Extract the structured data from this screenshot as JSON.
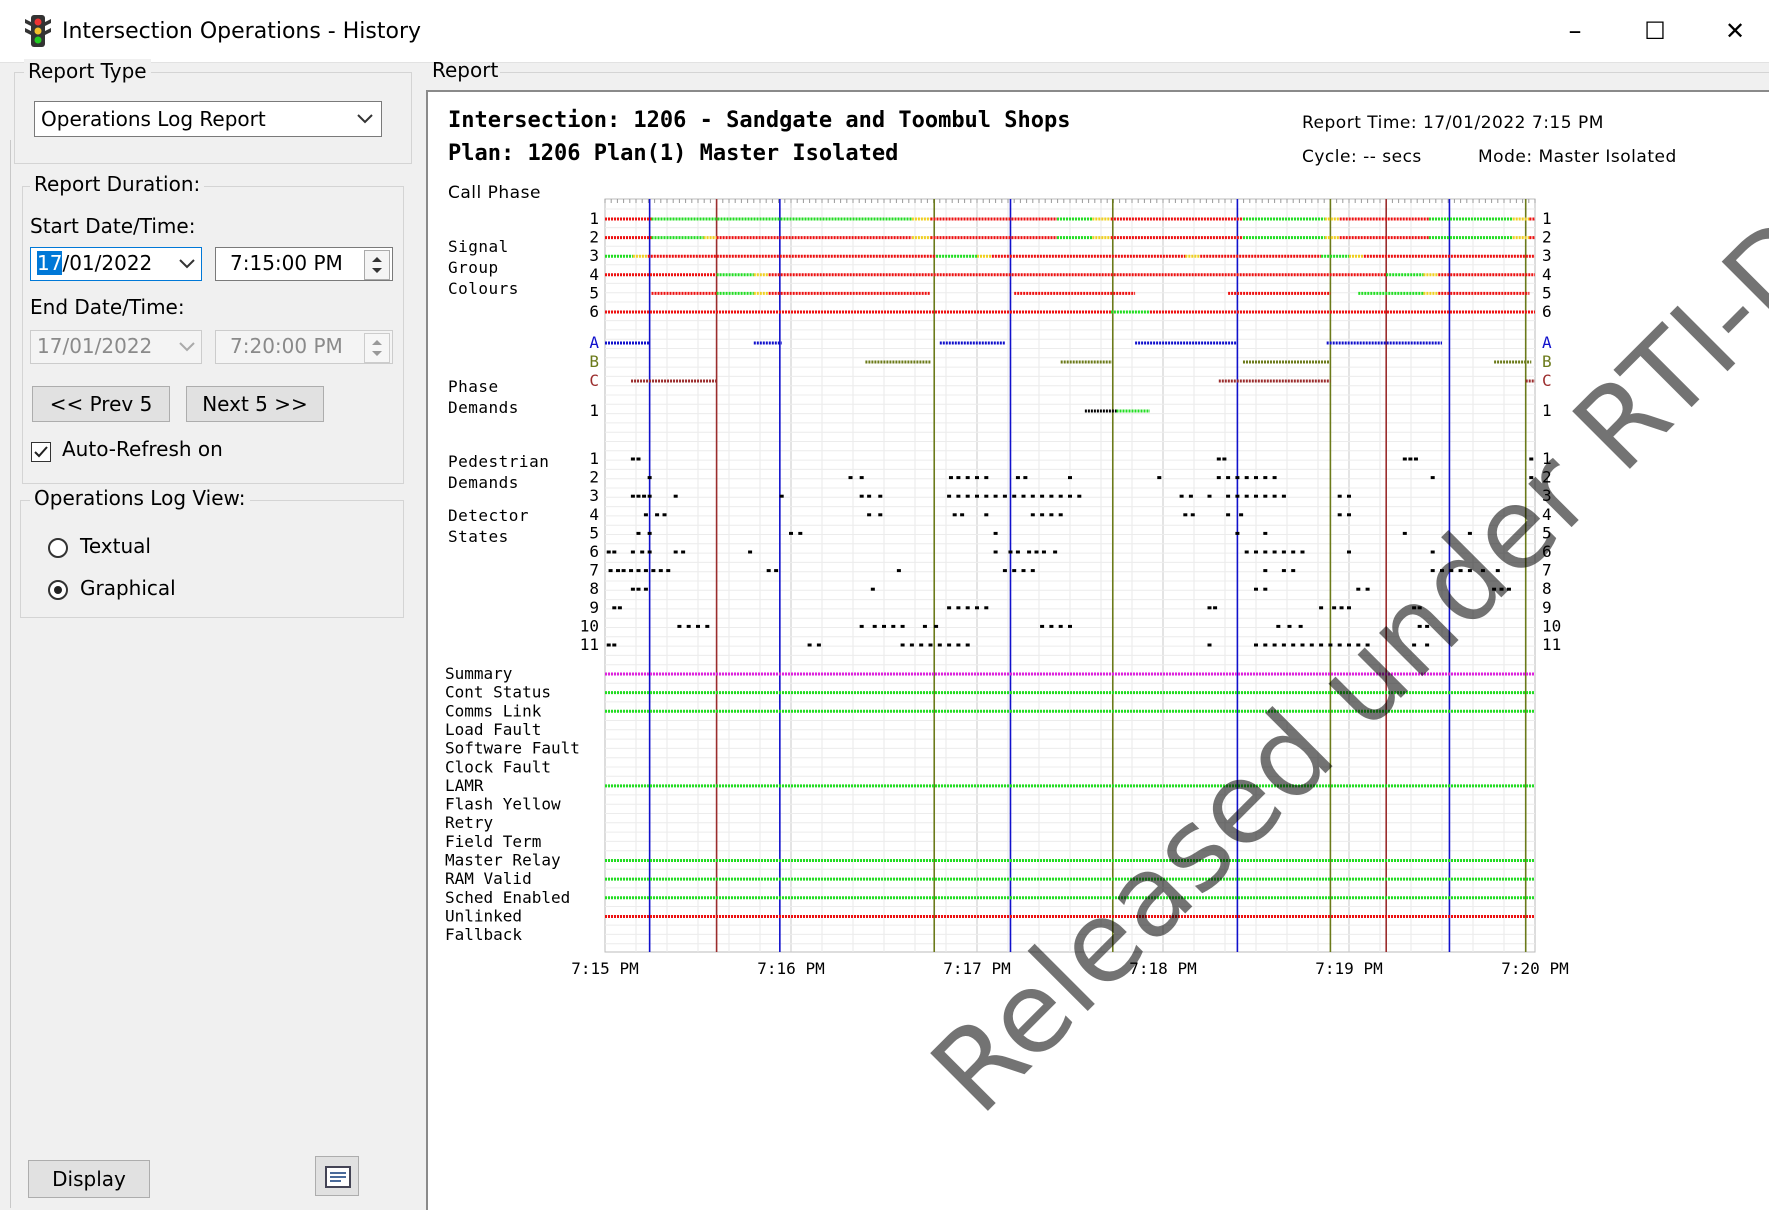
{
  "window": {
    "title": "Intersection Operations - History",
    "icon": "traffic-light-icon",
    "controls": [
      "–",
      "☐",
      "✕"
    ]
  },
  "report_type": {
    "group_label": "Report Type",
    "selected": "Operations Log Report"
  },
  "duration": {
    "group_label": "Report Duration:",
    "start_label": "Start Date/Time:",
    "start_date_sel": "17",
    "start_date_rest": "/01/2022",
    "start_time": "7:15:00 PM",
    "end_label": "End Date/Time:",
    "end_date": "17/01/2022",
    "end_time": "7:20:00 PM",
    "prev_label": "<< Prev 5",
    "next_label": "Next 5 >>",
    "auto_refresh_label": "Auto-Refresh on",
    "auto_refresh_checked": true
  },
  "log_view": {
    "group_label": "Operations Log View:",
    "options": [
      "Textual",
      "Graphical"
    ],
    "selected": "Graphical"
  },
  "footer": {
    "display_label": "Display"
  },
  "report": {
    "pane_label": "Report",
    "intersection": "Intersection: 1206 - Sandgate and Toombul Shops",
    "plan": "Plan: 1206 Plan(1) Master Isolated",
    "report_time": "Report Time:  17/01/2022 7:15 PM",
    "cycle": "Cycle: -- secs",
    "mode": "Mode: Master Isolated",
    "call_phase_label": "Call Phase",
    "watermark": "Released under RTI-DTMR"
  },
  "chart_data": {
    "type": "timeline",
    "x_ticks": [
      "7:15 PM",
      "7:16 PM",
      "7:17 PM",
      "7:18 PM",
      "7:19 PM",
      "7:20 PM"
    ],
    "x_range_min": [
      0,
      5
    ],
    "colors": {
      "red": "#ee1111",
      "green": "#22dd22",
      "yellow": "#f0d020",
      "blue": "#1111cc",
      "olive": "#6b7a1a",
      "maroon": "#9b2d2d",
      "magenta": "#dd22dd",
      "black": "#000000"
    },
    "section_labels": {
      "signal_group": "Signal\nGroup\nColours",
      "phase": "Phase\nDemands",
      "ped": "Pedestrian\nDemands",
      "detector": "Detector\nStates"
    },
    "signal_groups": [
      {
        "label": "1",
        "segments": [
          [
            0,
            0.25,
            "red"
          ],
          [
            0.25,
            1.65,
            "green"
          ],
          [
            1.65,
            1.75,
            "yellow"
          ],
          [
            1.75,
            2.43,
            "red"
          ],
          [
            2.43,
            2.62,
            "green"
          ],
          [
            2.62,
            2.72,
            "yellow"
          ],
          [
            2.72,
            3.43,
            "red"
          ],
          [
            3.43,
            3.87,
            "green"
          ],
          [
            3.87,
            3.95,
            "yellow"
          ],
          [
            3.95,
            4.43,
            "red"
          ],
          [
            4.43,
            4.88,
            "green"
          ],
          [
            4.88,
            4.97,
            "yellow"
          ],
          [
            4.97,
            5,
            "red"
          ]
        ]
      },
      {
        "label": "2",
        "segments": [
          [
            0,
            0.25,
            "red"
          ],
          [
            0.25,
            0.53,
            "green"
          ],
          [
            0.53,
            0.6,
            "yellow"
          ],
          [
            0.6,
            1.65,
            "red"
          ],
          [
            1.65,
            1.75,
            "yellow"
          ],
          [
            1.75,
            2.43,
            "red"
          ],
          [
            2.43,
            2.62,
            "green"
          ],
          [
            2.62,
            2.72,
            "yellow"
          ],
          [
            2.72,
            3.43,
            "red"
          ],
          [
            3.43,
            3.87,
            "green"
          ],
          [
            3.87,
            3.95,
            "yellow"
          ],
          [
            3.95,
            4.43,
            "red"
          ],
          [
            4.43,
            4.88,
            "green"
          ],
          [
            4.88,
            4.97,
            "yellow"
          ],
          [
            4.97,
            5,
            "red"
          ]
        ]
      },
      {
        "label": "3",
        "segments": [
          [
            0,
            0.15,
            "green"
          ],
          [
            0.15,
            0.23,
            "yellow"
          ],
          [
            0.23,
            1.78,
            "red"
          ],
          [
            1.78,
            2.0,
            "green"
          ],
          [
            2.0,
            2.08,
            "yellow"
          ],
          [
            2.08,
            3.12,
            "red"
          ],
          [
            3.12,
            3.2,
            "yellow"
          ],
          [
            3.2,
            3.85,
            "red"
          ],
          [
            3.85,
            4.0,
            "green"
          ],
          [
            4.0,
            4.08,
            "yellow"
          ],
          [
            4.08,
            5,
            "red"
          ]
        ]
      },
      {
        "label": "4",
        "segments": [
          [
            0,
            0.6,
            "red"
          ],
          [
            0.6,
            0.8,
            "green"
          ],
          [
            0.8,
            0.88,
            "yellow"
          ],
          [
            0.88,
            4.2,
            "red"
          ],
          [
            4.2,
            4.4,
            "green"
          ],
          [
            4.4,
            4.48,
            "yellow"
          ],
          [
            4.48,
            5,
            "red"
          ]
        ]
      },
      {
        "label": "5",
        "segments": [
          [
            0.25,
            0.6,
            "red"
          ],
          [
            0.6,
            0.8,
            "green"
          ],
          [
            0.8,
            0.88,
            "yellow"
          ],
          [
            0.88,
            1.75,
            "red"
          ],
          [
            2.2,
            2.85,
            "red"
          ],
          [
            3.35,
            3.9,
            "red"
          ],
          [
            4.05,
            4.4,
            "green"
          ],
          [
            4.4,
            4.48,
            "yellow"
          ],
          [
            4.48,
            4.97,
            "red"
          ]
        ]
      },
      {
        "label": "6",
        "segments": [
          [
            0,
            2.72,
            "red"
          ],
          [
            2.72,
            2.93,
            "green"
          ],
          [
            2.93,
            5,
            "red"
          ]
        ]
      }
    ],
    "phase_demands": [
      {
        "label": "A",
        "color": "blue",
        "segments": [
          [
            0,
            0.24
          ],
          [
            0.8,
            0.95
          ],
          [
            1.8,
            2.15
          ],
          [
            2.85,
            3.4
          ],
          [
            3.88,
            4.5
          ]
        ]
      },
      {
        "label": "B",
        "color": "olive",
        "segments": [
          [
            1.4,
            1.75
          ],
          [
            2.45,
            2.73
          ],
          [
            3.43,
            3.9
          ],
          [
            4.78,
            4.98
          ]
        ]
      },
      {
        "label": "C",
        "color": "maroon",
        "segments": [
          [
            0.14,
            0.6
          ],
          [
            3.3,
            3.9
          ],
          [
            4.95,
            5
          ]
        ]
      }
    ],
    "ped_demands": [
      {
        "label": "1",
        "segments": [
          [
            2.58,
            2.75,
            "black"
          ],
          [
            2.75,
            2.93,
            "green"
          ]
        ]
      }
    ],
    "detectors": [
      {
        "label": "1",
        "points": [
          0.15,
          0.18,
          3.3,
          3.33,
          4.3,
          4.33,
          4.36,
          4.98
        ]
      },
      {
        "label": "2",
        "points": [
          0.24,
          1.32,
          1.38,
          1.86,
          1.9,
          1.95,
          2.0,
          2.05,
          2.22,
          2.26,
          2.5,
          2.98,
          3.3,
          3.35,
          3.4,
          3.45,
          3.5,
          3.55,
          3.6,
          4.45,
          4.98
        ]
      },
      {
        "label": "3",
        "points": [
          0.15,
          0.18,
          0.21,
          0.24,
          0.38,
          0.95,
          1.38,
          1.42,
          1.48,
          1.85,
          1.9,
          1.95,
          2.0,
          2.05,
          2.1,
          2.15,
          2.2,
          2.25,
          2.3,
          2.35,
          2.4,
          2.45,
          2.5,
          2.55,
          3.1,
          3.15,
          3.25,
          3.35,
          3.4,
          3.45,
          3.5,
          3.55,
          3.6,
          3.65,
          3.95,
          4.0
        ]
      },
      {
        "label": "4",
        "points": [
          0.22,
          0.28,
          0.32,
          1.42,
          1.48,
          1.88,
          1.92,
          2.05,
          2.3,
          2.35,
          2.4,
          2.45,
          3.12,
          3.16,
          3.35,
          3.42,
          3.95,
          4.0
        ]
      },
      {
        "label": "5",
        "points": [
          0.18,
          0.24,
          1.0,
          1.05,
          2.1,
          3.4,
          3.55,
          4.3,
          4.65
        ]
      },
      {
        "label": "6",
        "points": [
          0.02,
          0.05,
          0.15,
          0.2,
          0.24,
          0.38,
          0.42,
          0.78,
          2.1,
          2.18,
          2.22,
          2.28,
          2.32,
          2.36,
          2.42,
          3.45,
          3.5,
          3.55,
          3.6,
          3.65,
          3.7,
          3.75,
          4.0,
          4.45
        ]
      },
      {
        "label": "7",
        "points": [
          0.03,
          0.07,
          0.1,
          0.14,
          0.18,
          0.22,
          0.26,
          0.3,
          0.34,
          0.88,
          0.92,
          1.58,
          2.15,
          2.2,
          2.25,
          2.3,
          3.55,
          3.65,
          3.7,
          4.45,
          4.5,
          4.55,
          4.6,
          4.65,
          4.72,
          4.8
        ]
      },
      {
        "label": "8",
        "points": [
          0.15,
          0.18,
          0.22,
          1.44,
          3.5,
          3.55,
          4.05,
          4.1,
          4.78,
          4.82,
          4.86
        ]
      },
      {
        "label": "9",
        "points": [
          0.05,
          0.08,
          1.85,
          1.9,
          1.95,
          2.0,
          2.05,
          3.25,
          3.28,
          3.85,
          3.92,
          3.96,
          4.0,
          4.35,
          4.38
        ]
      },
      {
        "label": "10",
        "points": [
          0.4,
          0.45,
          0.5,
          0.55,
          1.38,
          1.45,
          1.5,
          1.55,
          1.6,
          1.72,
          1.78,
          2.35,
          2.4,
          2.45,
          2.5,
          3.62,
          3.68,
          3.74,
          4.38,
          4.42
        ]
      },
      {
        "label": "11",
        "points": [
          0.02,
          0.05,
          1.1,
          1.15,
          1.6,
          1.65,
          1.7,
          1.75,
          1.8,
          1.85,
          1.9,
          1.95,
          3.25,
          3.5,
          3.55,
          3.6,
          3.65,
          3.7,
          3.75,
          3.8,
          3.85,
          3.9,
          3.95,
          4.0,
          4.05,
          4.1,
          4.35,
          4.42
        ]
      }
    ],
    "status_rows": [
      {
        "label": "Summary",
        "color": "magenta"
      },
      {
        "label": "Cont Status",
        "color": "green"
      },
      {
        "label": "Comms Link",
        "color": "green"
      },
      {
        "label": "Load Fault",
        "color": ""
      },
      {
        "label": "Software Fault",
        "color": ""
      },
      {
        "label": "Clock Fault",
        "color": ""
      },
      {
        "label": "LAMR",
        "color": "green"
      },
      {
        "label": "Flash Yellow",
        "color": ""
      },
      {
        "label": "Retry",
        "color": ""
      },
      {
        "label": "Field Term",
        "color": ""
      },
      {
        "label": "Master Relay",
        "color": "green"
      },
      {
        "label": "RAM Valid",
        "color": "green"
      },
      {
        "label": "Sched Enabled",
        "color": "green"
      },
      {
        "label": "Unlinked",
        "color": "red"
      },
      {
        "label": "Fallback",
        "color": ""
      }
    ],
    "vertical_markers": [
      {
        "t": 0.24,
        "color": "blue"
      },
      {
        "t": 0.6,
        "color": "maroon"
      },
      {
        "t": 0.94,
        "color": "blue"
      },
      {
        "t": 1.77,
        "color": "olive"
      },
      {
        "t": 2.18,
        "color": "blue"
      },
      {
        "t": 2.73,
        "color": "olive"
      },
      {
        "t": 3.4,
        "color": "blue"
      },
      {
        "t": 3.9,
        "color": "olive"
      },
      {
        "t": 4.2,
        "color": "maroon"
      },
      {
        "t": 4.54,
        "color": "blue"
      },
      {
        "t": 4.95,
        "color": "olive"
      }
    ]
  }
}
